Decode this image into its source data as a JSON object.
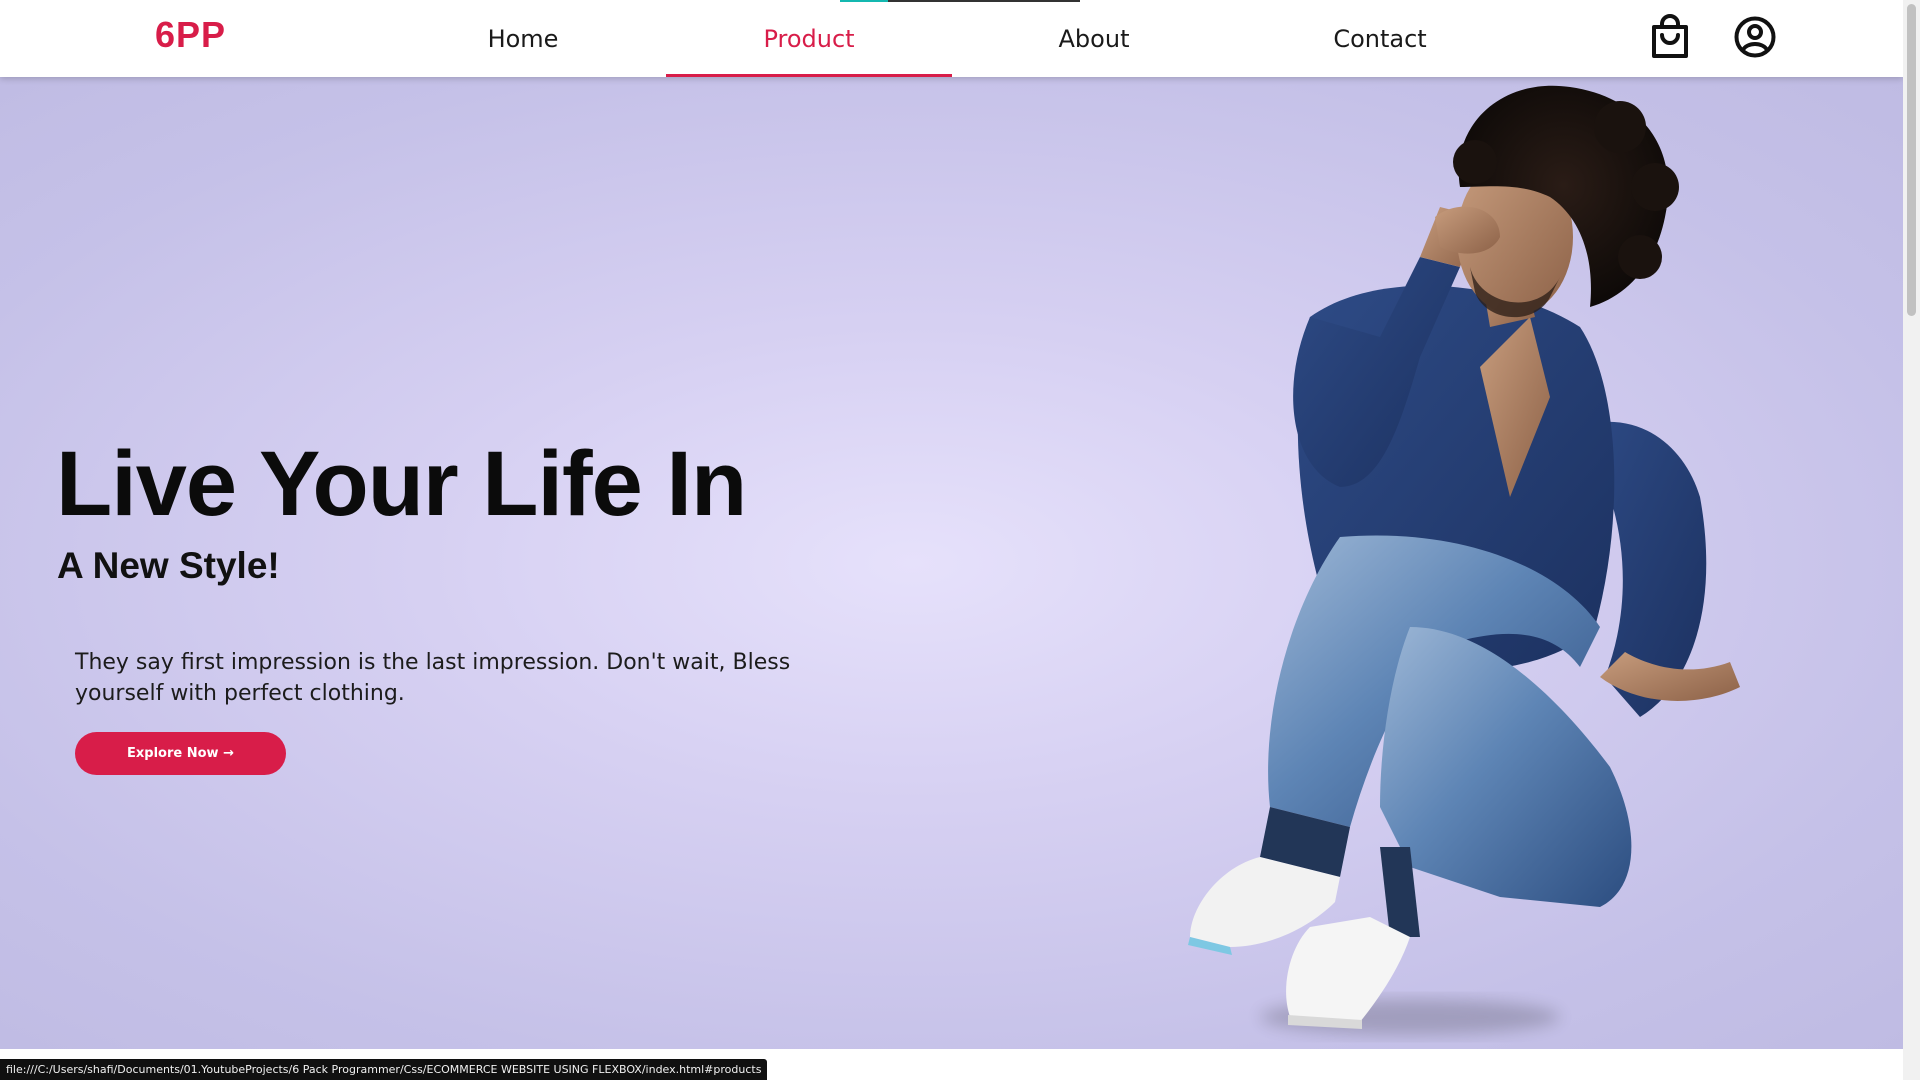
{
  "brand": {
    "logo_text": "6PP",
    "accent_color": "#d81d49"
  },
  "nav": {
    "links": [
      {
        "label": "Home",
        "active": false
      },
      {
        "label": "Product",
        "active": true
      },
      {
        "label": "About",
        "active": false
      },
      {
        "label": "Contact",
        "active": false
      }
    ],
    "icons": [
      "shopping-bag-icon",
      "account-circle-icon"
    ]
  },
  "page_loading": {
    "progress": 0.2,
    "color": "#14b8b0"
  },
  "hero": {
    "title": "Live Your Life In",
    "subtitle": "A New Style!",
    "description": "They say first impression is the last impression. Don't wait, Bless yourself with perfect clothing.",
    "button_label": "Explore Now →",
    "background_color": "#d6d0f2"
  },
  "status_bar": {
    "url": "file:///C:/Users/shafi/Documents/01.YoutubeProjects/6 Pack Programmer/Css/ECOMMERCE WEBSITE USING FLEXBOX/index.html#products"
  },
  "scrollbar": {
    "position": 0.0
  }
}
